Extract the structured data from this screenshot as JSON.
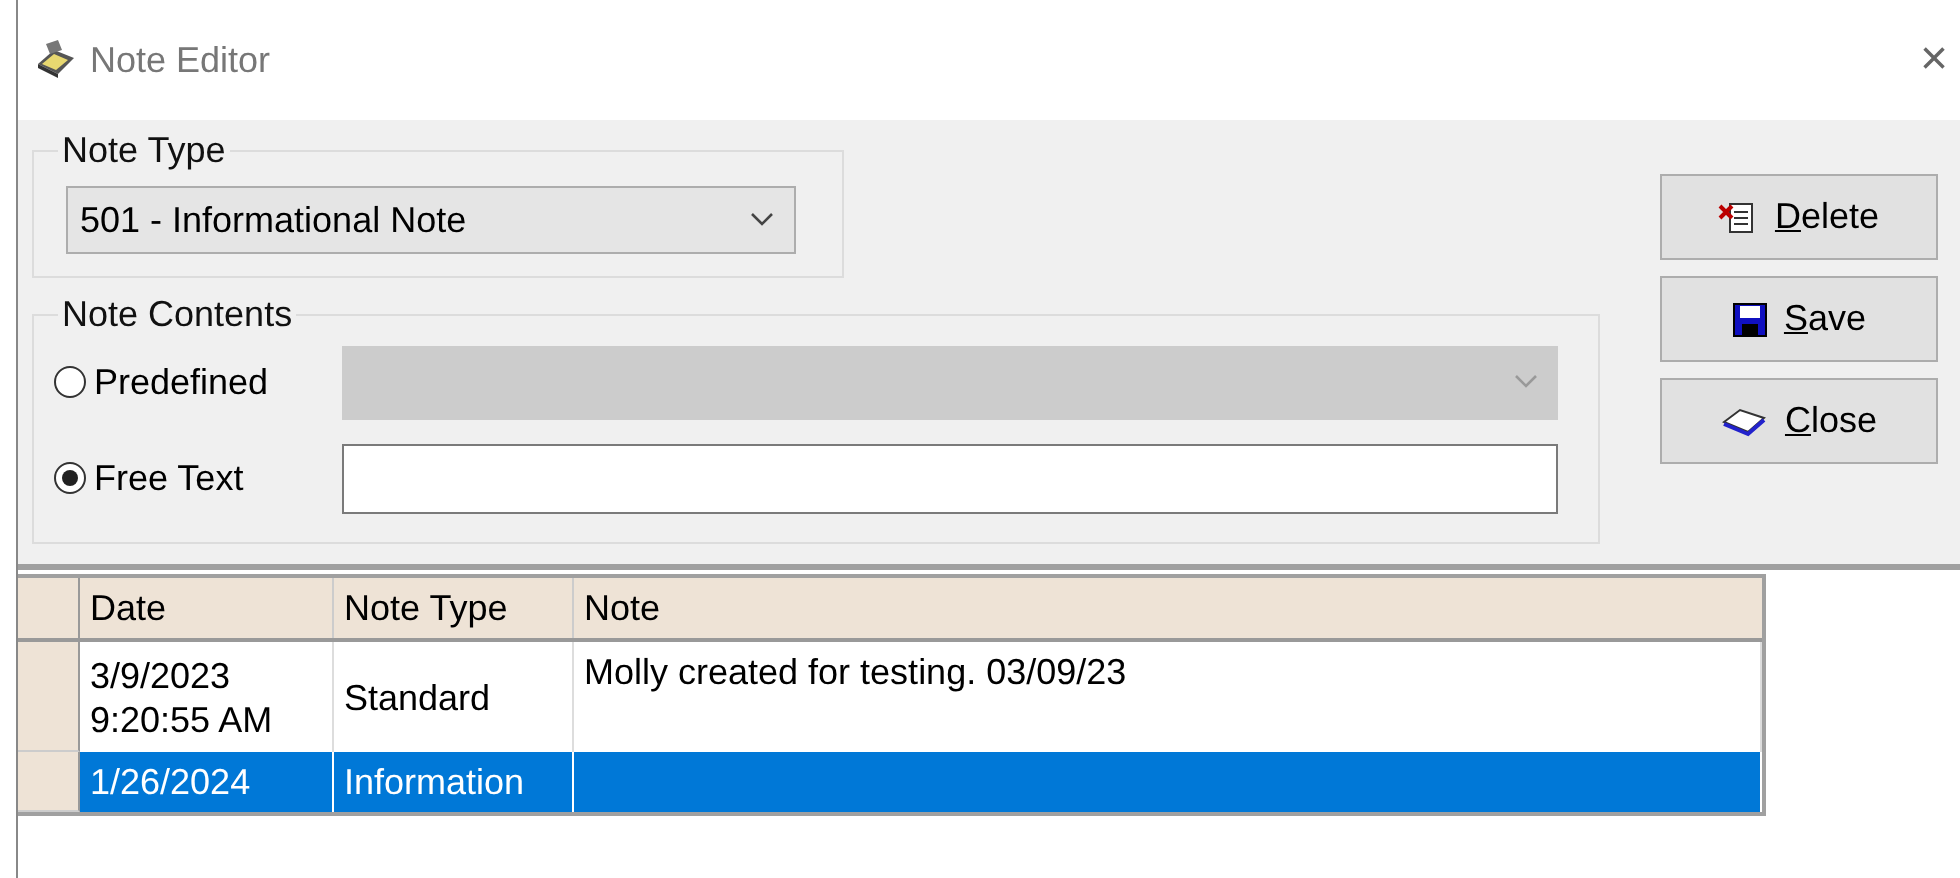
{
  "window": {
    "title": "Note Editor",
    "close": "×"
  },
  "note_type": {
    "legend": "Note Type",
    "value": "501 - Informational Note"
  },
  "note_contents": {
    "legend": "Note Contents",
    "options": [
      {
        "label": "Predefined",
        "selected": false,
        "kind": "dropdown",
        "disabled": true
      },
      {
        "label": "Free Text",
        "selected": true,
        "kind": "text",
        "disabled": false
      }
    ]
  },
  "buttons": [
    {
      "label": "Delete",
      "kind": "delete"
    },
    {
      "label": "Save",
      "kind": "save"
    },
    {
      "label": "Close",
      "kind": "close"
    }
  ],
  "table": {
    "columns": [
      "Date",
      "Note Type",
      "Note"
    ],
    "rows": [
      {
        "cells": [
          "3/9/2023\n9:20:55 AM",
          "Standard",
          "Molly created for testing. 03/09/23"
        ],
        "selected": false
      },
      {
        "cells": [
          "1/26/2024",
          "Information",
          ""
        ],
        "selected": true
      }
    ]
  }
}
